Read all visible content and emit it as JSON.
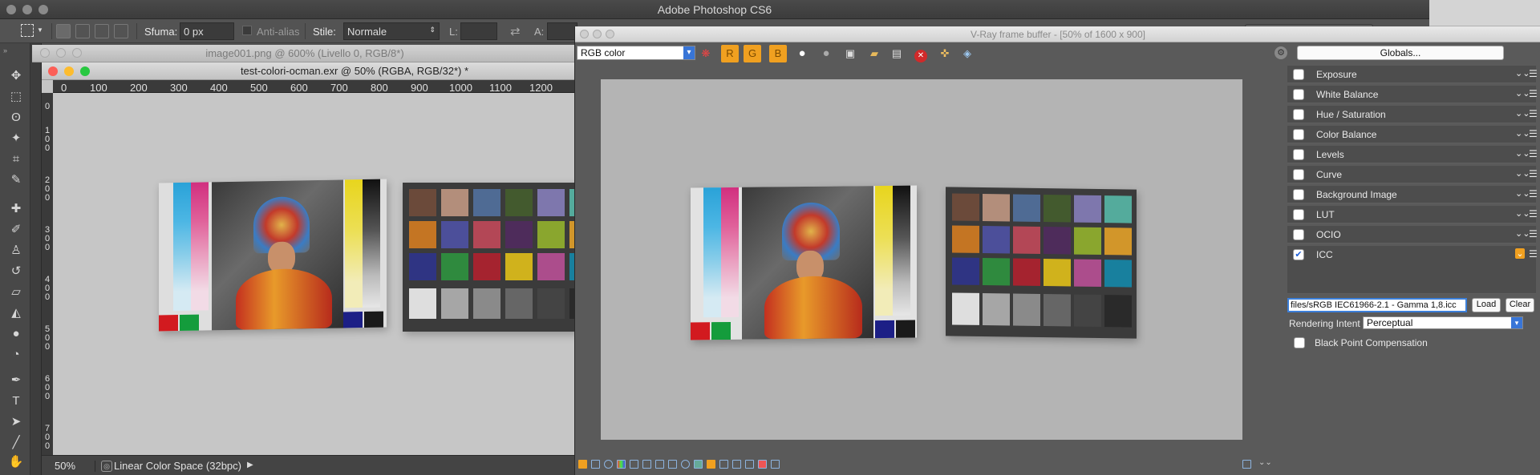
{
  "photoshop": {
    "app_title": "Adobe Photoshop CS6",
    "options": {
      "feather_label": "Sfuma:",
      "feather_value": "0 px",
      "antialias_label": "Anti-alias",
      "style_label": "Stile:",
      "style_value": "Normale",
      "width_label": "L:",
      "height_label": "A:"
    },
    "tools": [
      "move-icon",
      "marquee-icon",
      "lasso-icon",
      "magic-wand-icon",
      "crop-icon",
      "eyedropper-icon",
      "healing-icon",
      "brush-icon",
      "stamp-icon",
      "history-brush-icon",
      "eraser-icon",
      "bucket-icon",
      "blur-icon",
      "dodge-icon",
      "pen-icon",
      "type-icon",
      "path-select-icon",
      "line-icon",
      "hand-icon"
    ],
    "doc_back_title": "image001.png @ 600% (Livello 0, RGB/8*)",
    "doc_front_title": "test-colori-ocman.exr @ 50% (RGBA, RGB/32*) *",
    "ruler_top": [
      "0",
      "100",
      "200",
      "300",
      "400",
      "500",
      "600",
      "700",
      "800",
      "900",
      "1000",
      "1100",
      "1200"
    ],
    "ruler_side": [
      "1 0 0",
      "2 0 0",
      "3 0 0",
      "4 0 0",
      "5 0 0",
      "6 0 0",
      "7 0 0"
    ],
    "status": {
      "zoom": "50%",
      "info": "Linear Color Space (32bpc)"
    }
  },
  "vfb": {
    "title": "V-Ray frame buffer - [50% of 1600 x 900]",
    "channel": "RGB color",
    "globals_label": "Globals...",
    "corrections": [
      {
        "label": "Exposure",
        "checked": false
      },
      {
        "label": "White Balance",
        "checked": false
      },
      {
        "label": "Hue / Saturation",
        "checked": false
      },
      {
        "label": "Color Balance",
        "checked": false
      },
      {
        "label": "Levels",
        "checked": false
      },
      {
        "label": "Curve",
        "checked": false
      },
      {
        "label": "Background Image",
        "checked": false
      },
      {
        "label": "LUT",
        "checked": false
      },
      {
        "label": "OCIO",
        "checked": false
      },
      {
        "label": "ICC",
        "checked": true
      }
    ],
    "icc": {
      "path": "files/sRGB IEC61966-2.1 - Gamma 1,8.icc",
      "load_label": "Load",
      "clear_label": "Clear",
      "rendering_intent_label": "Rendering Intent",
      "rendering_intent_value": "Perceptual",
      "bpc_label": "Black Point Compensation"
    }
  },
  "colors": {
    "accent_orange": "#f0a020",
    "select_blue": "#3875d7",
    "ps_dark": "#535353"
  }
}
